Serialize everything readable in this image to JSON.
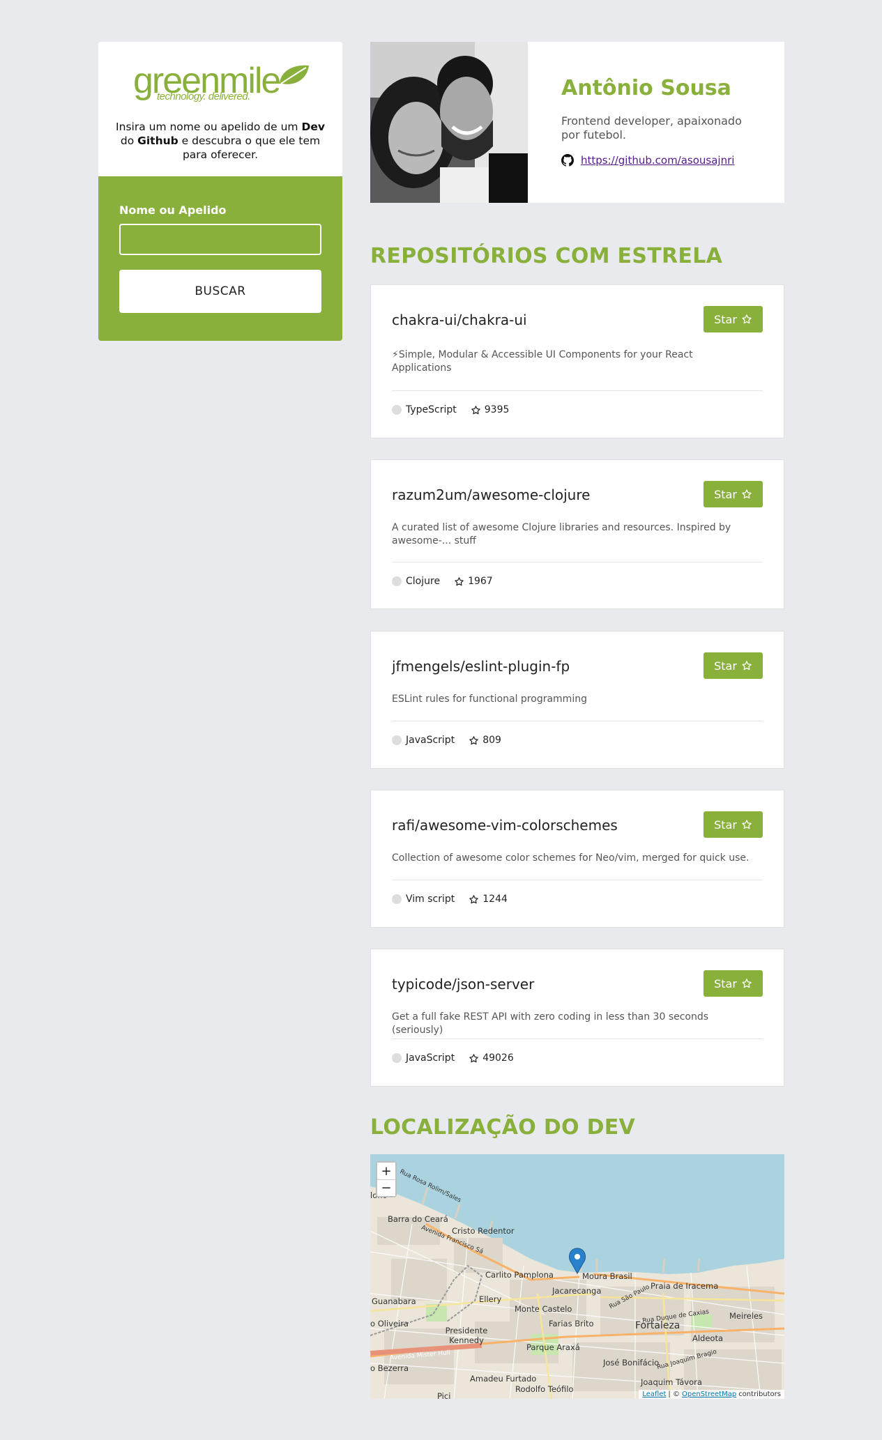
{
  "sidebar": {
    "logo": {
      "word": "greenmile",
      "tagline": "technology. delivered."
    },
    "intro": {
      "p1": "Insira um nome ou apelido de um ",
      "dev": "Dev",
      "p2": " do ",
      "github": "Github",
      "p3": " e descubra o que ele tem para oferecer."
    },
    "form": {
      "label": "Nome ou Apelido",
      "value": "",
      "placeholder": "",
      "button": "BUSCAR"
    }
  },
  "profile": {
    "name": "Antônio Sousa",
    "bio": "Frontend developer, apaixonado por futebol.",
    "link": "https://github.com/asousajnri"
  },
  "starred": {
    "title": "REPOSITÓRIOS COM ESTRELA",
    "star_label": "Star",
    "repos": [
      {
        "name": "chakra-ui/chakra-ui",
        "description": "⚡Simple, Modular & Accessible UI Components for your React Applications",
        "language": "TypeScript",
        "stars": "9395"
      },
      {
        "name": "razum2um/awesome-clojure",
        "description": "A curated list of awesome Clojure libraries and resources. Inspired by awesome-... stuff",
        "language": "Clojure",
        "stars": "1967"
      },
      {
        "name": "jfmengels/eslint-plugin-fp",
        "description": "ESLint rules for functional programming",
        "language": "JavaScript",
        "stars": "809"
      },
      {
        "name": "rafi/awesome-vim-colorschemes",
        "description": "Collection of awesome color schemes for Neo/vim, merged for quick use.",
        "language": "Vim script",
        "stars": "1244"
      },
      {
        "name": "typicode/json-server",
        "description": "Get a full fake REST API with zero coding in less than 30 seconds (seriously)",
        "language": "JavaScript",
        "stars": "49026"
      }
    ]
  },
  "location": {
    "title": "LOCALIZAÇÃO DO DEV",
    "zoom_in": "+",
    "zoom_out": "−",
    "attribution": {
      "leaflet": "Leaflet",
      "sep": "| ©",
      "osm": "OpenStreetMap",
      "contrib": "contributors"
    },
    "labels": {
      "barra": "Barra do Ceará",
      "cristo": "Cristo Redentor",
      "carlito": "Carlito Pamplona",
      "moura": "Moura Brasil",
      "praia": "Praia de Iracema",
      "guanabara": "Guanabara",
      "ellery": "Ellery",
      "jacarecanga": "Jacarecanga",
      "monte": "Monte Castelo",
      "farias": "Farias Brito",
      "fortaleza": "Fortaleza",
      "meireles": "Meireles",
      "oliveira": "o Oliveira",
      "presidente": "Presidente Kennedy",
      "parque": "Parque Araxá",
      "aldeota": "Aldeota",
      "jose": "José Bonifácio",
      "bezerra": "o Bezerra",
      "amadeu": "Amadeu Furtado",
      "joaquim": "Joaquim Távora",
      "rodolfo": "Rodolfo Teófilo",
      "pici": "Pici",
      "ono": "lono",
      "st_rosa": "Rua Rosa Rolim/Sales",
      "st_francisco": "Avenida Francisco Sá",
      "st_mister": "Avenida Mister Hull",
      "st_sao_paulo": "Rua São Paulo",
      "st_duque": "Rua Duque de Caxias",
      "st_bragio": "Rua Joaquim Bragio"
    }
  },
  "colors": {
    "accent": "#8ab03c",
    "background": "#e9eaed",
    "link": "#551a8b"
  }
}
